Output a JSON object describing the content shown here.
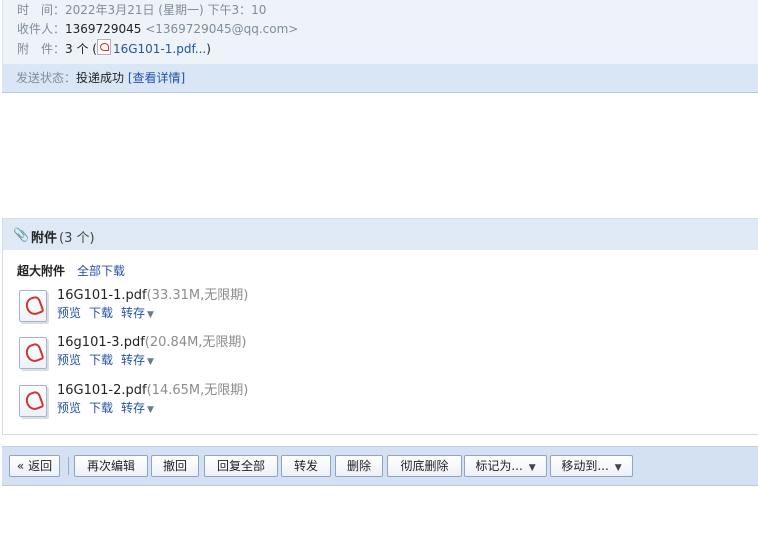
{
  "header": {
    "time_label": "时　间：",
    "time_value": "2022年3月21日 (星期一) 下午3：10",
    "recipient_label": "收件人：",
    "recipient_name": "1369729045",
    "recipient_email": "<1369729045@qq.com>",
    "attachment_label": "附　件：",
    "attachment_count": "3 个 (",
    "attachment_link": "16G101-1.pdf...",
    "attachment_close": ")"
  },
  "status": {
    "label": "发送状态：",
    "value": "投递成功",
    "details_link": "[查看详情]"
  },
  "attachments": {
    "title": "附件",
    "count": "(3 个)",
    "big_label": "超大附件",
    "download_all": "全部下载",
    "files": [
      {
        "name": "16G101-1.pdf",
        "meta": "(33.31M,无限期)",
        "preview": "预览",
        "download": "下载",
        "save": "转存"
      },
      {
        "name": "16g101-3.pdf",
        "meta": "(20.84M,无限期)",
        "preview": "预览",
        "download": "下载",
        "save": "转存"
      },
      {
        "name": "16G101-2.pdf",
        "meta": "(14.65M,无限期)",
        "preview": "预览",
        "download": "下载",
        "save": "转存"
      }
    ]
  },
  "toolbar": {
    "back": "« 返回",
    "re_edit": "再次编辑",
    "recall": "撤回",
    "reply_all": "回复全部",
    "forward": "转发",
    "delete": "删除",
    "delete_perm": "彻底删除",
    "mark_as": "标记为...",
    "move_to": "移动到..."
  }
}
